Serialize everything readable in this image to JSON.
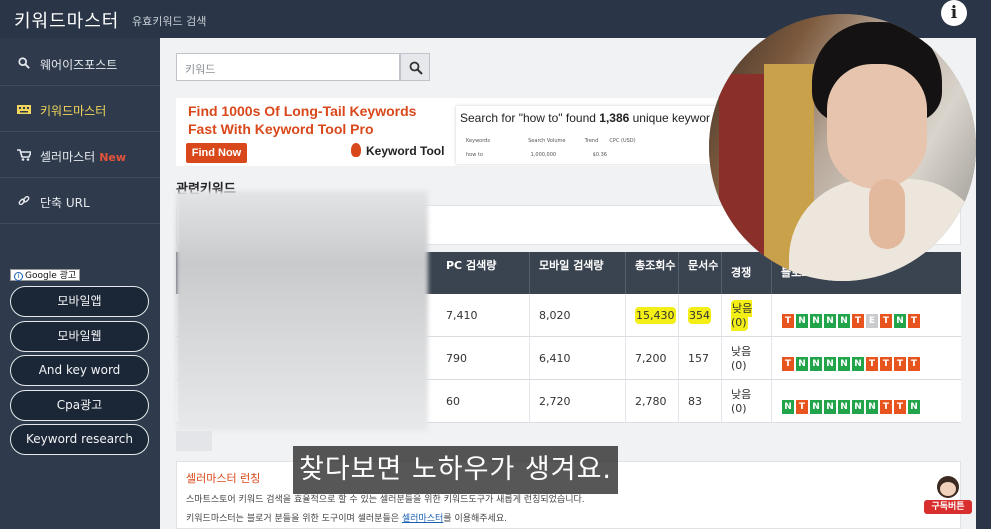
{
  "header": {
    "brand": "키워드마스터",
    "subtitle": "유효키워드 검색"
  },
  "sidebar": {
    "items": [
      {
        "label": "웨어이즈포스트",
        "icon": "search-icon",
        "new": ""
      },
      {
        "label": "키워드마스터",
        "icon": "keyboard-icon",
        "new": ""
      },
      {
        "label": "셀러마스터",
        "icon": "cart-icon",
        "new": "New"
      },
      {
        "label": "단축 URL",
        "icon": "link-icon",
        "new": ""
      }
    ],
    "ad_badge": "Google 광고",
    "pills": [
      "모바일앱",
      "모바일웹",
      "And key word",
      "Cpa광고",
      "Keyword research"
    ]
  },
  "search": {
    "placeholder": "키워드"
  },
  "banner": {
    "headline": "Find 1000s Of Long-Tail Keywords Fast With Keyword Tool Pro",
    "button": "Find Now",
    "logo": "Keyword Tool",
    "query_pre": "Search for \"how to\" found ",
    "query_count": "1,386",
    "query_post": " unique keywor",
    "mini_cols": [
      "Keywords",
      "Search Volume",
      "Trend",
      "CPC (USD)"
    ],
    "mini_row": [
      "how to",
      "1,000,000",
      "",
      "$0.36"
    ]
  },
  "related": {
    "title": "관련키워드"
  },
  "table": {
    "headers": [
      "PC 검색량",
      "모바일 검색량",
      "총조회수",
      "문서수",
      "경쟁",
      "블로그순위 ▼"
    ],
    "rows": [
      {
        "pc": "7,410",
        "mobile": "8,020",
        "total": "15,430",
        "docs": "354",
        "comp": "낮음",
        "comp2": "(0)",
        "ranks": [
          "T",
          "N",
          "N",
          "N",
          "N",
          "T",
          "E",
          "T",
          "N",
          "T"
        ]
      },
      {
        "pc": "790",
        "mobile": "6,410",
        "total": "7,200",
        "docs": "157",
        "comp": "낮음",
        "comp2": "(0)",
        "ranks": [
          "T",
          "N",
          "N",
          "N",
          "N",
          "N",
          "T",
          "T",
          "T",
          "T"
        ]
      },
      {
        "pc": "60",
        "mobile": "2,720",
        "total": "2,780",
        "docs": "83",
        "comp": "낮음",
        "comp2": "(0)",
        "ranks": [
          "N",
          "T",
          "N",
          "N",
          "N",
          "N",
          "N",
          "T",
          "T",
          "N"
        ]
      }
    ]
  },
  "seller": {
    "title": "셀러마스터 런칭",
    "line1": "스마트스토어 키워드 검색을 효율적으로 할 수 있는 셀러분들을 위한 키워드도구가 새롭게 런칭되었습니다.",
    "line2_pre": "키워드마스터는 블로거 분들을 위한 도구이며 셀러분들은 ",
    "line2_link": "셀러마스터",
    "line2_post": "를 이용해주세요."
  },
  "video": {
    "subtitle": "찾다보면 노하우가 생겨요.",
    "subscribe": "구독버튼"
  },
  "colors": {
    "accent": "#d9481b",
    "rank_t": "#e8541e",
    "rank_n": "#21a44a",
    "highlight": "#f2ee16"
  }
}
